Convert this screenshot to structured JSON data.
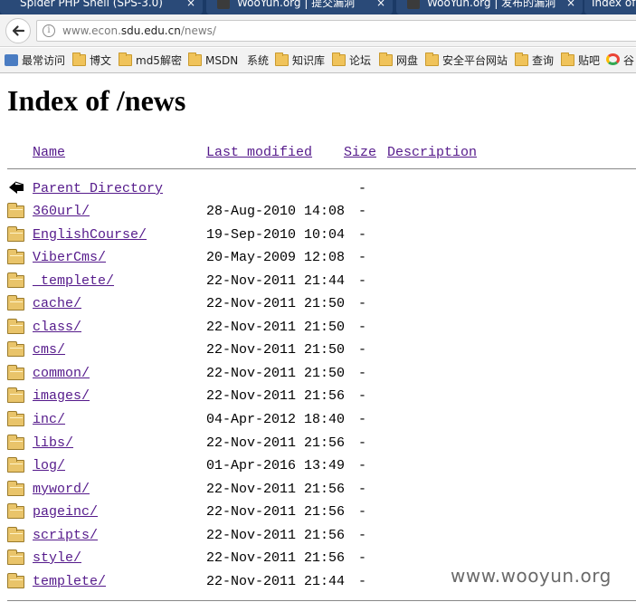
{
  "browser": {
    "tabs": [
      {
        "title": "Spider PHP Shell (SPS-3.0)",
        "close": "×"
      },
      {
        "title": "WooYun.org | 提交漏洞",
        "close": "×"
      },
      {
        "title": "WooYun.org | 发布的漏洞",
        "close": "×"
      },
      {
        "title": "Index of"
      }
    ],
    "address": {
      "url_prefix": "www.econ.",
      "url_host": "sdu.edu.cn",
      "url_path": "/news/",
      "info_glyph": "i"
    },
    "bookmarks": [
      {
        "label": "最常访问",
        "icon": "apps-icon"
      },
      {
        "label": "博文",
        "icon": "folder-icon"
      },
      {
        "label": "md5解密",
        "icon": "folder-icon"
      },
      {
        "label": "MSDN",
        "icon": "folder-icon"
      },
      {
        "label": "系统",
        "icon": "plain"
      },
      {
        "label": "知识库",
        "icon": "folder-icon"
      },
      {
        "label": "论坛",
        "icon": "folder-icon"
      },
      {
        "label": "网盘",
        "icon": "folder-icon"
      },
      {
        "label": "安全平台网站",
        "icon": "folder-icon"
      },
      {
        "label": "查询",
        "icon": "folder-icon"
      },
      {
        "label": "贴吧",
        "icon": "folder-icon"
      },
      {
        "label": "谷",
        "icon": "google-icon"
      }
    ]
  },
  "listing": {
    "title": "Index of /news",
    "columns": {
      "name": "Name",
      "modified": "Last modified",
      "size": "Size",
      "description": "Description"
    },
    "parent": {
      "name": "Parent Directory",
      "size": "-"
    },
    "entries": [
      {
        "name": "360url/",
        "modified": "28-Aug-2010 14:08",
        "size": "-"
      },
      {
        "name": "EnglishCourse/",
        "modified": "19-Sep-2010 10:04",
        "size": "-"
      },
      {
        "name": "ViberCms/",
        "modified": "20-May-2009 12:08",
        "size": "-"
      },
      {
        "name": "_templete/",
        "modified": "22-Nov-2011 21:44",
        "size": "-"
      },
      {
        "name": "cache/",
        "modified": "22-Nov-2011 21:50",
        "size": "-"
      },
      {
        "name": "class/",
        "modified": "22-Nov-2011 21:50",
        "size": "-"
      },
      {
        "name": "cms/",
        "modified": "22-Nov-2011 21:50",
        "size": "-"
      },
      {
        "name": "common/",
        "modified": "22-Nov-2011 21:50",
        "size": "-"
      },
      {
        "name": "images/",
        "modified": "22-Nov-2011 21:56",
        "size": "-"
      },
      {
        "name": "inc/",
        "modified": "04-Apr-2012 18:40",
        "size": "-"
      },
      {
        "name": "libs/",
        "modified": "22-Nov-2011 21:56",
        "size": "-"
      },
      {
        "name": "log/",
        "modified": "01-Apr-2016 13:49",
        "size": "-"
      },
      {
        "name": "myword/",
        "modified": "22-Nov-2011 21:56",
        "size": "-"
      },
      {
        "name": "pageinc/",
        "modified": "22-Nov-2011 21:56",
        "size": "-"
      },
      {
        "name": "scripts/",
        "modified": "22-Nov-2011 21:56",
        "size": "-"
      },
      {
        "name": "style/",
        "modified": "22-Nov-2011 21:56",
        "size": "-"
      },
      {
        "name": "templete/",
        "modified": "22-Nov-2011 21:44",
        "size": "-"
      }
    ]
  },
  "watermark": "www.wooyun.org",
  "colors": {
    "link": "#551a8b",
    "tabbar": "#1b3a66",
    "folder": "#e9c46a"
  }
}
